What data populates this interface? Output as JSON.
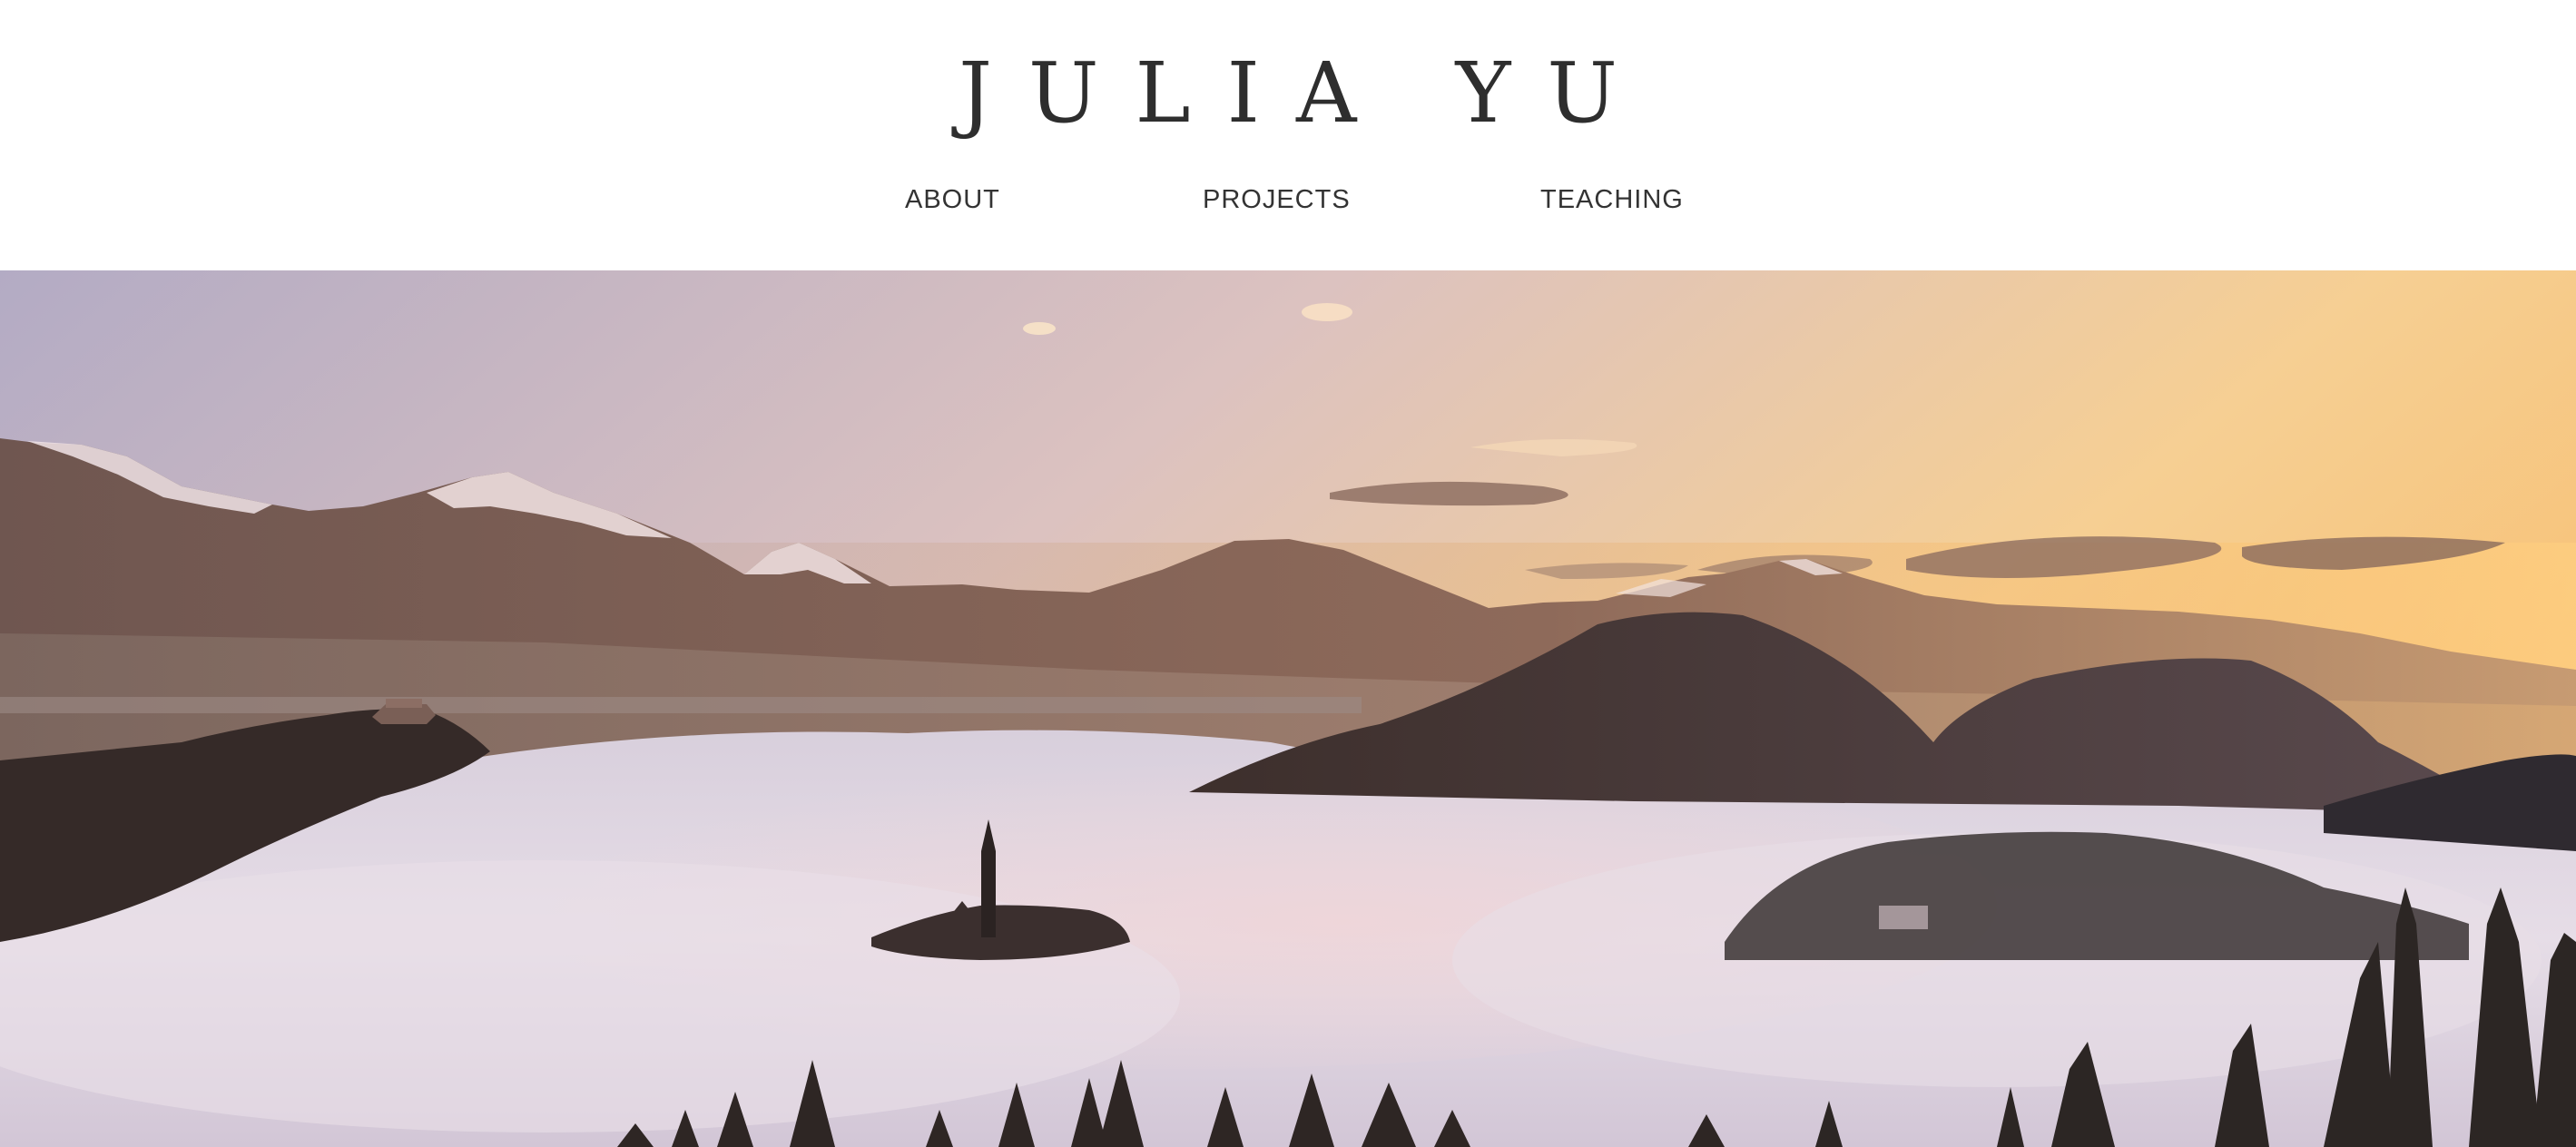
{
  "site": {
    "title": "JULIA YU"
  },
  "nav": {
    "items": [
      {
        "label": "ABOUT"
      },
      {
        "label": "PROJECTS"
      },
      {
        "label": "TEACHING"
      }
    ]
  },
  "hero": {
    "image": "landscape-photo",
    "colors": {
      "sky_left": "#b7aec4",
      "sky_right": "#f4c98a",
      "mountain": "#6e5552",
      "fog": "#e2d8e4",
      "trees": "#2e2624"
    }
  }
}
